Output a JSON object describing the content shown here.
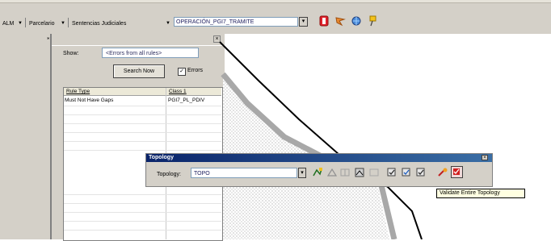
{
  "toolbar": {
    "item1_label": "ALM",
    "item2_label": "Parcelario",
    "item3_label": "Sentencias Judiciales",
    "expression_value": "OPERACIÓN_PGI7_TRAMITE"
  },
  "panel": {
    "show_label": "Show:",
    "show_value": "<Errors from all rules>",
    "search_button_label": "Search Now",
    "errors_checkbox_label": "Errors",
    "columns": [
      "Rule Type",
      "Class 1"
    ],
    "rows": [
      [
        "Must Not Have Gaps",
        "PGI7_PL_PDIV"
      ]
    ]
  },
  "topology": {
    "title": "Topology",
    "label": "Topology:",
    "value": "TOPO",
    "tooltip": "Validate Entire Topology"
  },
  "colors": {
    "ui_gray": "#d4d0c8",
    "title_blue": "#0a246a",
    "tooltip_bg": "#ffffe1"
  }
}
